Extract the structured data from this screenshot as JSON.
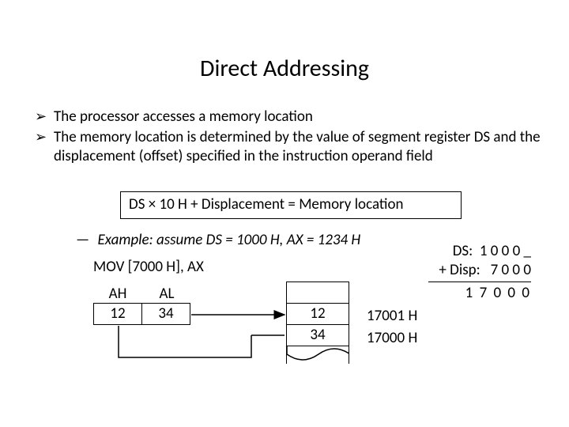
{
  "title": "Direct Addressing",
  "bullets": [
    "The processor accesses a memory location",
    "The memory location is determined by the value of segment register DS and the displacement (offset) specified in the instruction operand field"
  ],
  "formula": "DS × 10 H  +  Displacement  =  Memory location",
  "example_label": "Example:",
  "example_body": "assume DS = 1000 H, AX = 1234 H",
  "instruction": "MOV [7000 H], AX",
  "reg": {
    "ah_label": "AH",
    "al_label": "AL",
    "ah_value": "12",
    "al_value": "34"
  },
  "memory": {
    "cell_hi": "12",
    "cell_lo": "34",
    "addr_hi": "17001 H",
    "addr_lo": "17000 H"
  },
  "calc": {
    "line1": "DS:  1 0 0 0 _",
    "line2": "+ Disp:   7 0 0 0",
    "result": "1 7 0 0 0"
  }
}
